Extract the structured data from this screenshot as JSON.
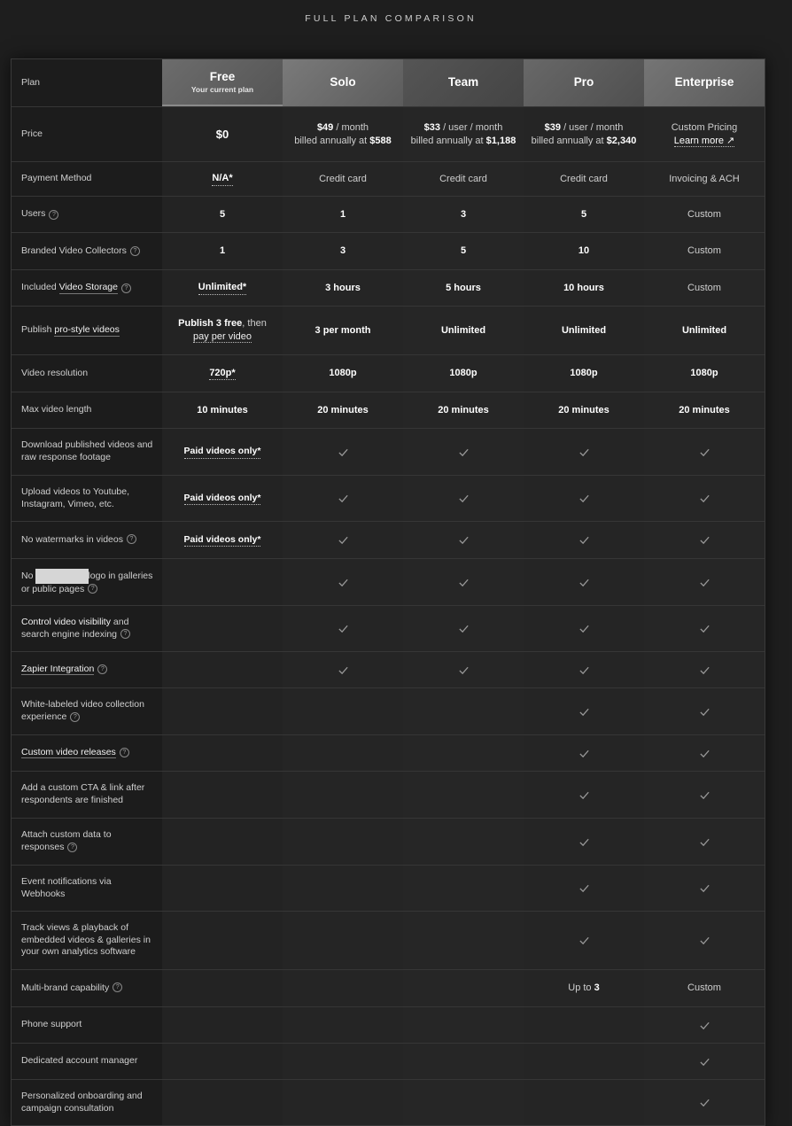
{
  "page_title": "FULL PLAN COMPARISON",
  "header": {
    "feature_label": "Plan",
    "plans": [
      {
        "name": "Free",
        "subtitle": "Your current plan"
      },
      {
        "name": "Solo"
      },
      {
        "name": "Team"
      },
      {
        "name": "Pro"
      },
      {
        "name": "Enterprise"
      }
    ]
  },
  "price": {
    "label": "Price",
    "free": "$0",
    "solo": {
      "amount": "$49",
      "unit": " / month",
      "billed_prefix": "billed annually at ",
      "billed": "$588"
    },
    "team": {
      "amount": "$33",
      "unit": " / user / month",
      "billed_prefix": "billed annually at ",
      "billed": "$1,188"
    },
    "pro": {
      "amount": "$39",
      "unit": " / user / month",
      "billed_prefix": "billed annually at ",
      "billed": "$2,340"
    },
    "enterprise": {
      "text": "Custom Pricing",
      "link": "Learn more ↗"
    }
  },
  "rows": {
    "payment": {
      "label": "Payment Method",
      "values": [
        "N/A*",
        "Credit card",
        "Credit card",
        "Credit card",
        "Invoicing & ACH"
      ]
    },
    "users": {
      "label": "Users",
      "values": [
        "5",
        "1",
        "3",
        "5",
        "Custom"
      ]
    },
    "collectors": {
      "label": "Branded Video Collectors",
      "values": [
        "1",
        "3",
        "5",
        "10",
        "Custom"
      ]
    },
    "storage": {
      "label_prefix": "Included ",
      "label_link": "Video Storage",
      "values": [
        "Unlimited*",
        "3 hours",
        "5 hours",
        "10 hours",
        "Custom"
      ]
    },
    "publish": {
      "label_prefix": "Publish ",
      "label_link": "pro-style videos",
      "free_bold": "Publish 3 free",
      "free_rest": ", then",
      "free_link": "pay per video",
      "values": [
        "3 per month",
        "Unlimited",
        "Unlimited",
        "Unlimited"
      ]
    },
    "resolution": {
      "label": "Video resolution",
      "values": [
        "720p*",
        "1080p",
        "1080p",
        "1080p",
        "1080p"
      ]
    },
    "length": {
      "label": "Max video length",
      "values": [
        "10 minutes",
        "20 minutes",
        "20 minutes",
        "20 minutes",
        "20 minutes"
      ]
    },
    "download": {
      "label": "Download published videos and raw response footage",
      "free": "Paid videos only*"
    },
    "upload": {
      "label": "Upload videos to Youtube, Instagram, Vimeo, etc.",
      "free": "Paid videos only*"
    },
    "watermark": {
      "label": "No watermarks in videos",
      "free": "Paid videos only*"
    },
    "nologo": {
      "label_prefix": "No",
      "label_suffix": "logo in galleries or public pages"
    },
    "visibility": {
      "label_bold": "Control video visibility",
      "label_rest": " and search engine indexing"
    },
    "zapier": {
      "label_link": "Zapier Integration"
    },
    "whitelabel": {
      "label": "White-labeled video collection experience"
    },
    "releases": {
      "label_link": "Custom video releases"
    },
    "cta": {
      "label": "Add a custom CTA & link after respondents are finished"
    },
    "customdata": {
      "label": "Attach custom data to responses"
    },
    "webhooks": {
      "label": "Event notifications via Webhooks"
    },
    "analytics": {
      "label": "Track views & playback of embedded videos & galleries in your own analytics software"
    },
    "multibrand": {
      "label": "Multi-brand capability",
      "pro_prefix": "Up to ",
      "pro_value": "3",
      "enterprise": "Custom"
    },
    "phone": {
      "label": "Phone support"
    },
    "manager": {
      "label": "Dedicated account manager"
    },
    "onboarding": {
      "label": "Personalized onboarding and campaign consultation"
    }
  },
  "icons": {
    "check": "checkmark-icon",
    "help": "question-circle-icon",
    "external": "external-link-icon"
  },
  "help_glyph": "?"
}
